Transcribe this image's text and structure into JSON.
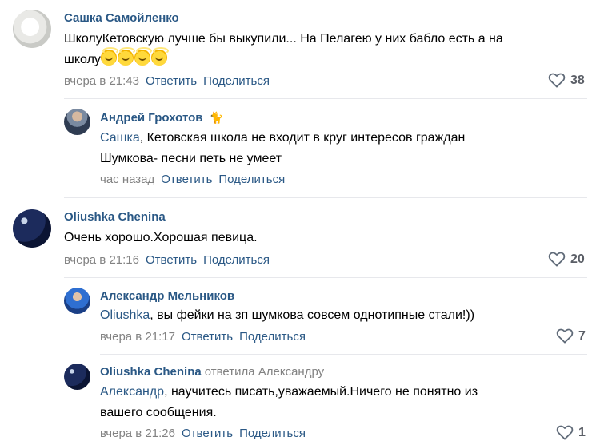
{
  "comments": [
    {
      "author": "Сашка Самойленко",
      "text_line1": "ШколуКетовскую лучше бы выкупили... На Пелагею у них бабло есть а на",
      "text_line2": "школу",
      "emoji": [
        "halo-smiley",
        "halo-smiley",
        "halo-smiley",
        "halo-smiley"
      ],
      "time": "вчера в 21:43",
      "reply": "Ответить",
      "share": "Поделиться",
      "likes": "38",
      "avatar": "white-flower"
    },
    {
      "author": "Андрей Грохотов",
      "author_badge": "cat-emoji",
      "mention": "Сашка",
      "text_line1_rest": ", Кетовская школа не входит в круг интересов граждан",
      "text_line2": "Шумкова- песни петь не умеет",
      "time": "час назад",
      "reply": "Ответить",
      "share": "Поделиться",
      "avatar": "man-in-suit"
    },
    {
      "author": "Oliushka Chenina",
      "text_line1": "Очень хорошо.Хорошая певица.",
      "time": "вчера в 21:16",
      "reply": "Ответить",
      "share": "Поделиться",
      "likes": "20",
      "avatar": "night-sky-moon"
    },
    {
      "author": "Александр Мельников",
      "mention": "Oliushka",
      "text_line1_rest": ", вы фейки на зп шумкова совсем однотипные стали!))",
      "time": "вчера в 21:17",
      "reply": "Ответить",
      "share": "Поделиться",
      "likes": "7",
      "avatar": "man-in-blue"
    },
    {
      "author": "Oliushka Chenina",
      "replied_to": "ответила Александру",
      "mention": "Александр",
      "text_line1_rest": ", научитесь писать,уважаемый.Ничего не понятно из",
      "text_line2": "вашего сообщения.",
      "time": "вчера в 21:26",
      "reply": "Ответить",
      "share": "Поделиться",
      "likes": "1",
      "avatar": "night-sky-moon"
    }
  ],
  "colors": {
    "link": "#2a5885",
    "meta": "#828282",
    "separator": "#e7e8ec"
  }
}
